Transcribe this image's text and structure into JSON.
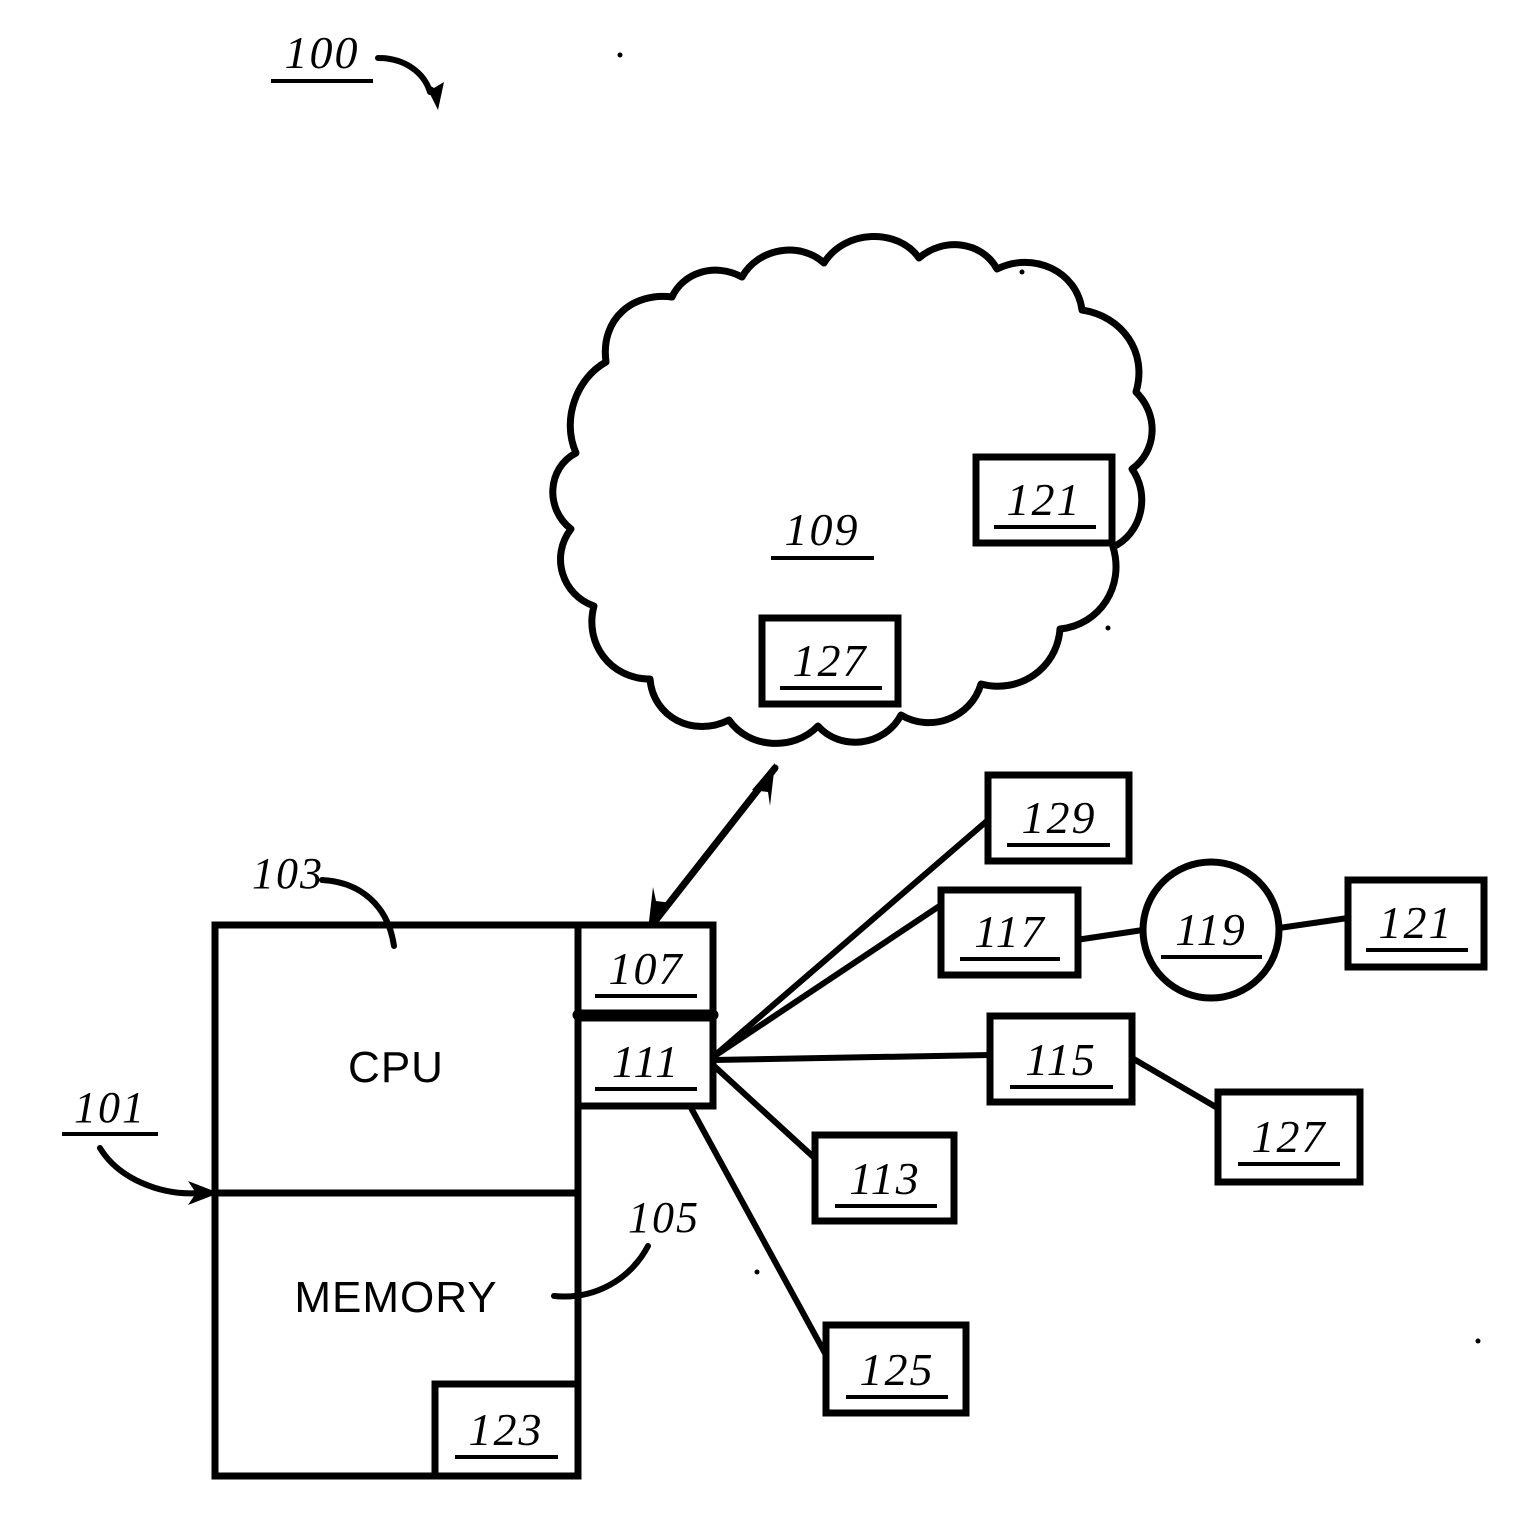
{
  "figure": {
    "title_ref": "100",
    "background_color": "#ffffff",
    "line_color": "#000000"
  },
  "main_unit": {
    "ref": "101",
    "cpu_label": "CPU",
    "cpu_ref": "103",
    "memory_label": "MEMORY",
    "memory_ref": "105",
    "memory_inner_ref": "123",
    "port_top_ref": "107",
    "port_bottom_ref": "111"
  },
  "cloud": {
    "ref": "109",
    "inner_box_upper_ref": "121",
    "inner_box_lower_ref": "127"
  },
  "peripherals": [
    {
      "ref": "129",
      "shape": "rect"
    },
    {
      "ref": "117",
      "shape": "rect"
    },
    {
      "ref": "119",
      "shape": "circle"
    },
    {
      "ref": "121",
      "shape": "rect"
    },
    {
      "ref": "115",
      "shape": "rect"
    },
    {
      "ref": "127",
      "shape": "rect"
    },
    {
      "ref": "113",
      "shape": "rect"
    },
    {
      "ref": "125",
      "shape": "rect"
    }
  ]
}
